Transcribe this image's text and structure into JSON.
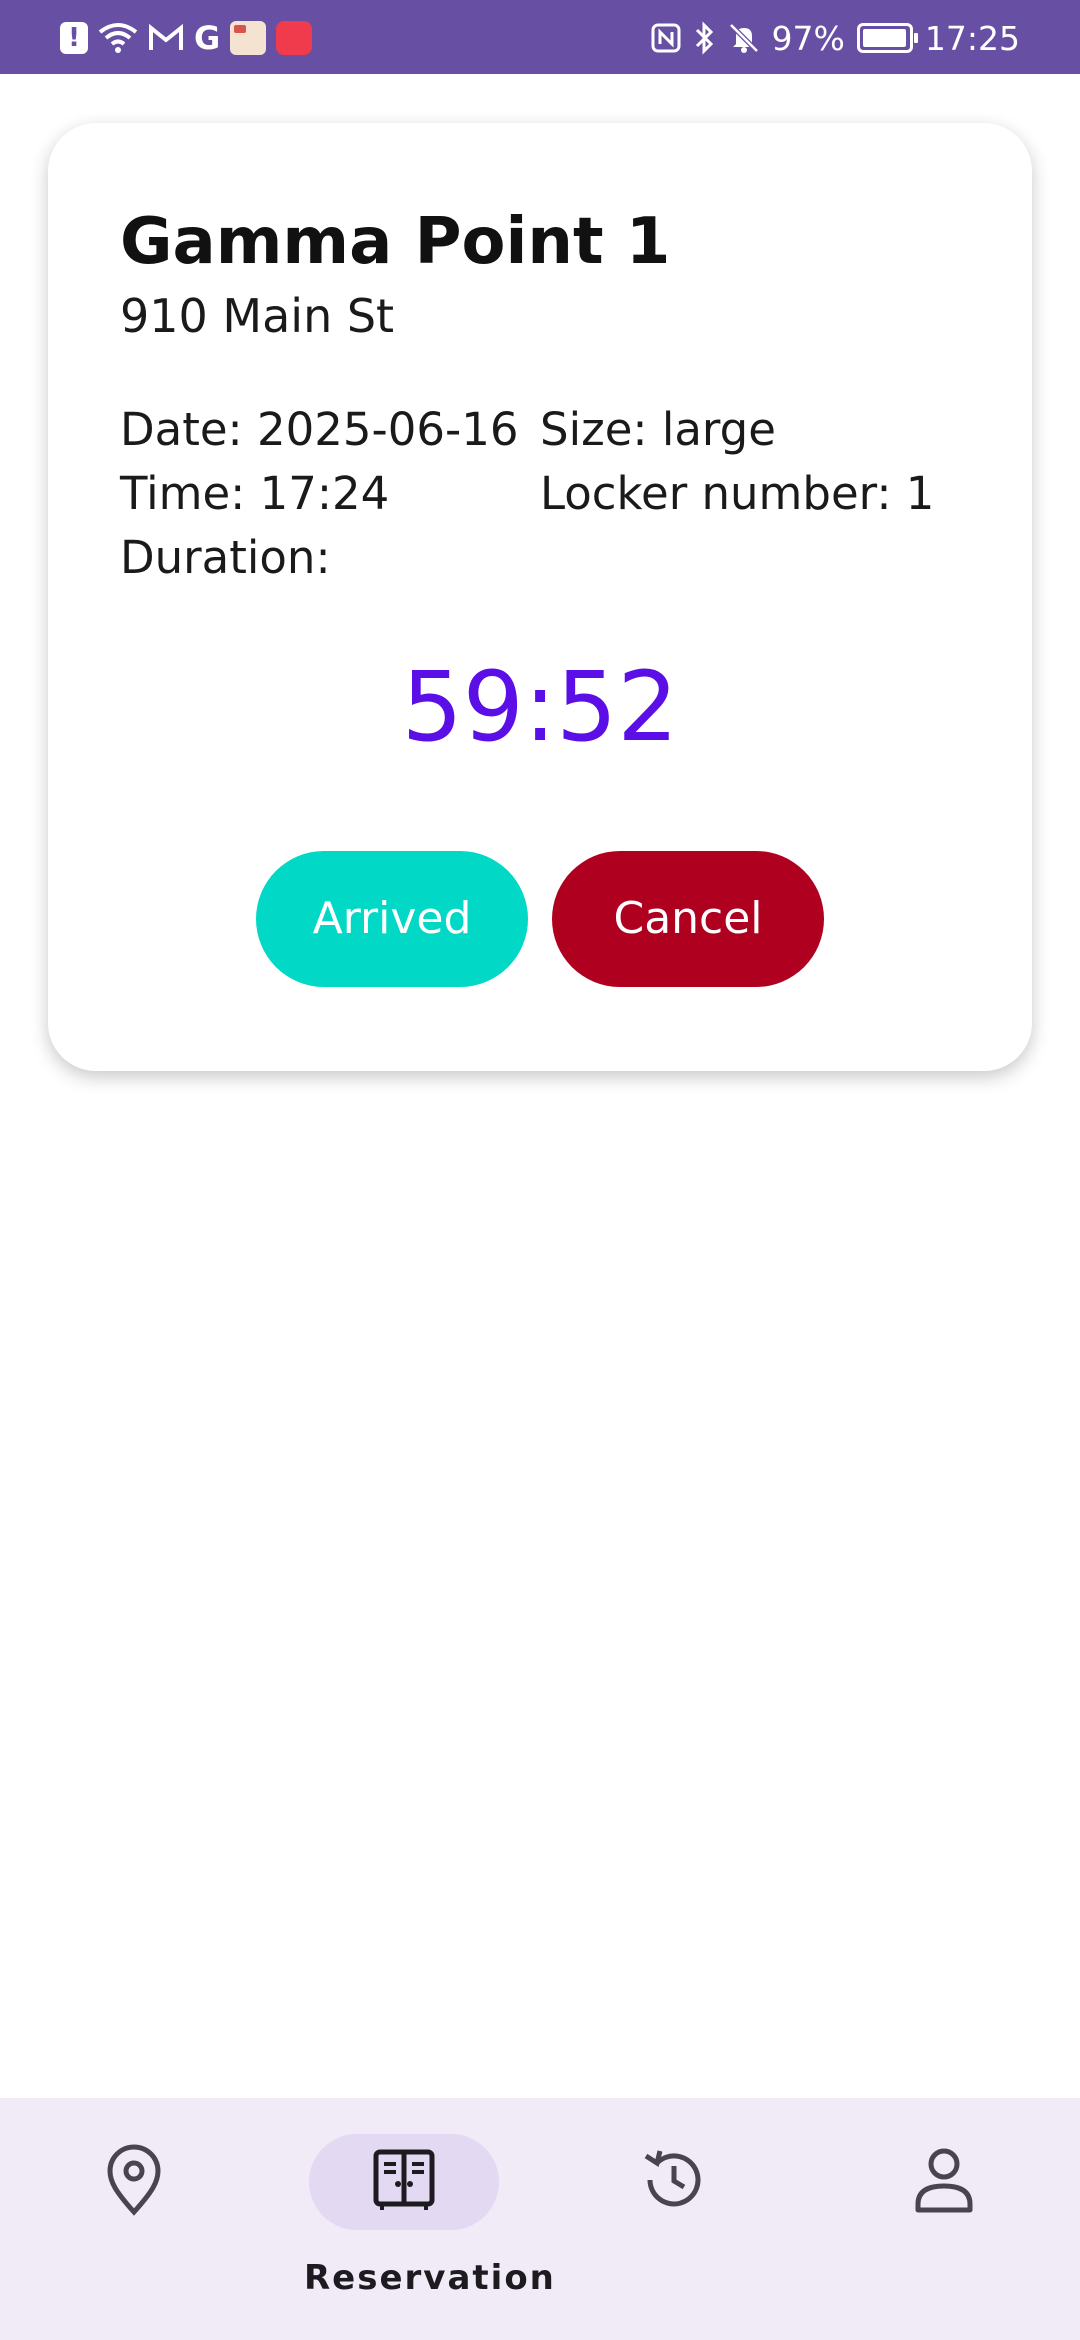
{
  "status_bar": {
    "left_icons": [
      "alert-icon",
      "wifi-icon",
      "gmail-icon",
      "google-icon",
      "shop-app-icon",
      "huawei-app-icon"
    ],
    "right_icons": [
      "nfc-icon",
      "bluetooth-icon",
      "mute-bell-icon",
      "battery-icon"
    ],
    "battery_text": "97%",
    "battery_level": 0.97,
    "time": "17:25",
    "bg_color": "#6750a4"
  },
  "reservation": {
    "title": "Gamma Point 1",
    "address": "910 Main St",
    "date_text": "Date: 2025-06-16",
    "time_text": "Time: 17:24",
    "duration_text": "Duration:",
    "size_text": "Size: large",
    "locker_text": "Locker number: 1",
    "countdown": "59:52",
    "countdown_color": "#5b0fe6",
    "arrived_label": "Arrived",
    "arrived_color": "#02d8c6",
    "cancel_label": "Cancel",
    "cancel_color": "#b00020"
  },
  "bottom_nav": {
    "items": [
      {
        "name": "map",
        "icon": "location-pin-icon",
        "label": ""
      },
      {
        "name": "reservation",
        "icon": "locker-icon",
        "label": "Reservation",
        "active": true
      },
      {
        "name": "history",
        "icon": "history-icon",
        "label": ""
      },
      {
        "name": "profile",
        "icon": "person-icon",
        "label": ""
      }
    ],
    "active_pill_color": "#e3d9f3",
    "bg_color": "#f1ebf7"
  }
}
